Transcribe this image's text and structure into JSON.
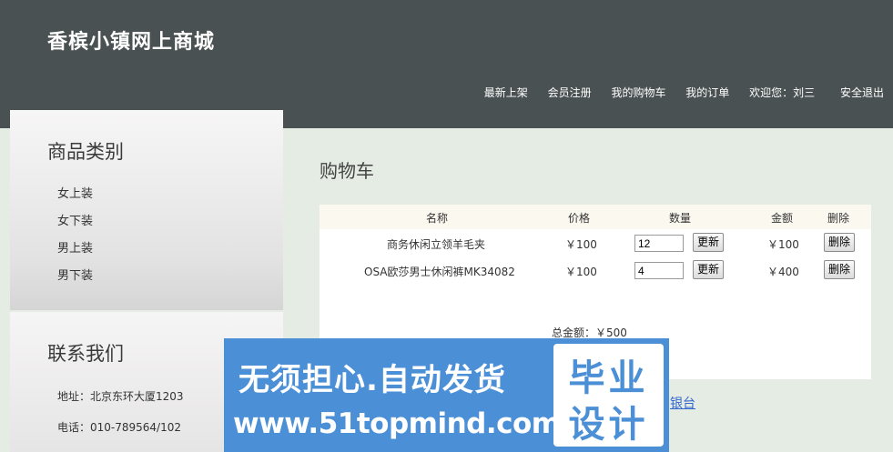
{
  "header": {
    "site_title": "香槟小镇网上商城",
    "nav": {
      "latest": "最新上架",
      "register": "会员注册",
      "cart": "我的购物车",
      "orders": "我的订单",
      "welcome": "欢迎您：刘三",
      "logout": "安全退出"
    }
  },
  "sidebar": {
    "category_title": "商品类别",
    "categories": [
      "女上装",
      "女下装",
      "男上装",
      "男下装"
    ],
    "contact_title": "联系我们",
    "address": "地址：北京东环大厦1203",
    "phone": "电话：010-789564/102"
  },
  "cart": {
    "title": "购物车",
    "columns": {
      "name": "名称",
      "price": "价格",
      "qty": "数量",
      "amount": "金额",
      "delete": "删除"
    },
    "rows": [
      {
        "name": "商务休闲立领羊毛夹",
        "price": "￥100",
        "qty": "12",
        "amount": "￥100"
      },
      {
        "name": "OSA欧莎男士休闲裤MK34082",
        "price": "￥100",
        "qty": "4",
        "amount": "￥400"
      }
    ],
    "update_label": "更新",
    "delete_label": "删除",
    "total": "总金额：￥500"
  },
  "link_fragment": "银台",
  "watermark": {
    "line1": "无须担心.自动发货",
    "line2": "www.51topmind.com",
    "badge_top": "毕业",
    "badge_bottom": "设计"
  },
  "colors": {
    "header_bg": "#4a5152",
    "page_bg": "#e4ece4",
    "banner_bg": "#4b8fd6",
    "link": "#3366cc"
  }
}
